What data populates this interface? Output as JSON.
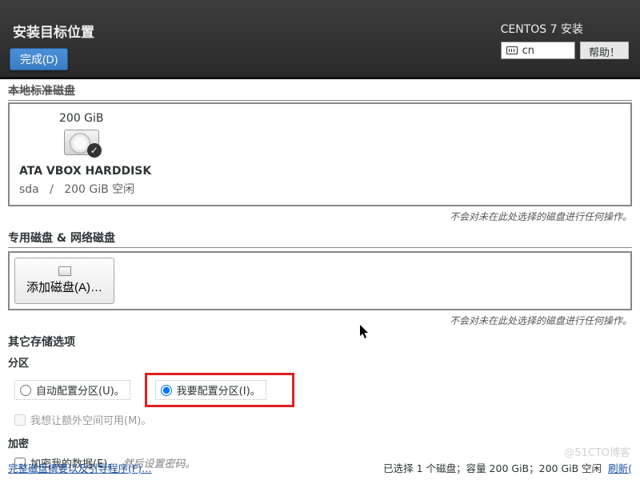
{
  "header": {
    "title": "安装目标位置",
    "done_label": "完成(D)",
    "installer_name": "CENTOS 7 安装",
    "keyboard_layout": "cn",
    "help_label": "帮助！"
  },
  "local_disks": {
    "section_title": "本地标准磁盘",
    "disk": {
      "size": "200 GiB",
      "name": "ATA VBOX HARDDISK",
      "dev": "sda",
      "sep": "/",
      "free": "200 GiB 空闲"
    },
    "note": "不会对未在此处选择的磁盘进行任何操作。"
  },
  "network_disks": {
    "section_title": "专用磁盘 & 网络磁盘",
    "add_label": "添加磁盘(A)…",
    "note": "不会对未在此处选择的磁盘进行任何操作。"
  },
  "storage": {
    "section_title": "其它存储选项",
    "partition_head": "分区",
    "radio_auto": "自动配置分区(U)。",
    "radio_manual": "我要配置分区(I)。",
    "extra_space": "我想让额外空间可用(M)。",
    "encrypt_head": "加密",
    "encrypt_label": "加密我的数据(E)。",
    "encrypt_hint": "然后设置密码。"
  },
  "footer": {
    "summary_link": "完整磁盘摘要以及引导程序(F)…",
    "selection": "已选择 1 个磁盘；容量 200 GiB；200 GiB 空闲",
    "refresh": "刷新("
  },
  "watermark": "@51CTO博客"
}
